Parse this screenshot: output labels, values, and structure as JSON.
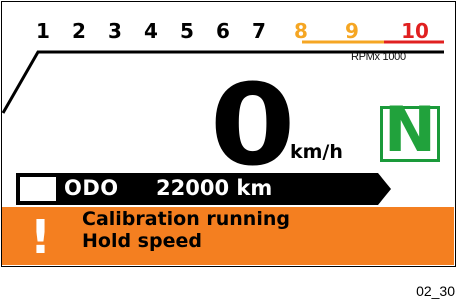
{
  "tachometer": {
    "marks": [
      {
        "label": "1",
        "color": "#000000"
      },
      {
        "label": "2",
        "color": "#000000"
      },
      {
        "label": "3",
        "color": "#000000"
      },
      {
        "label": "4",
        "color": "#000000"
      },
      {
        "label": "5",
        "color": "#000000"
      },
      {
        "label": "6",
        "color": "#000000"
      },
      {
        "label": "7",
        "color": "#000000"
      },
      {
        "label": "8",
        "color": "#f5a623"
      },
      {
        "label": "9",
        "color": "#f5a623"
      },
      {
        "label": "10",
        "color": "#e02020"
      }
    ],
    "unit": "RPMx 1000"
  },
  "speedometer": {
    "value": "0",
    "unit": "km/h"
  },
  "gear_indicator": {
    "value": "N",
    "color": "#21a23c"
  },
  "odometer": {
    "label": "ODO",
    "value": "22000 km"
  },
  "warning": {
    "icon": "exclamation-icon",
    "line1": "Calibration running",
    "line2": "Hold speed",
    "background": "#f47f20"
  },
  "figure_id": "02_30"
}
